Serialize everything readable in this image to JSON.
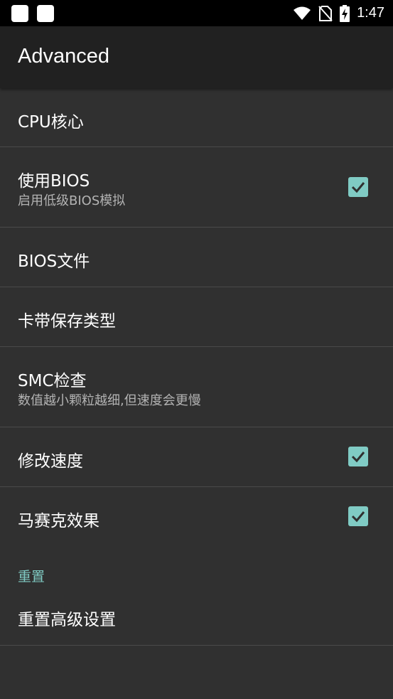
{
  "status_bar": {
    "time": "1:47",
    "icons": [
      "notification-icon",
      "notification-icon",
      "wifi-icon",
      "no-sim-icon",
      "battery-charging-icon"
    ]
  },
  "app_bar": {
    "title": "Advanced"
  },
  "preferences": [
    {
      "title": "CPU核心",
      "summary": null,
      "checked": null
    },
    {
      "title": "使用BIOS",
      "summary": "启用低级BIOS模拟",
      "checked": true
    },
    {
      "title": "BIOS文件",
      "summary": null,
      "checked": null
    },
    {
      "title": "卡带保存类型",
      "summary": null,
      "checked": null
    },
    {
      "title": "SMC检查",
      "summary": "数值越小颗粒越细,但速度会更慢",
      "checked": null
    },
    {
      "title": "修改速度",
      "summary": null,
      "checked": true
    },
    {
      "title": "马赛克效果",
      "summary": null,
      "checked": true
    }
  ],
  "reset_category": {
    "label": "重置",
    "items": [
      {
        "title": "重置高级设置"
      }
    ]
  },
  "colors": {
    "accent": "#80cbc4",
    "background": "#303030",
    "app_bar": "#212121"
  }
}
